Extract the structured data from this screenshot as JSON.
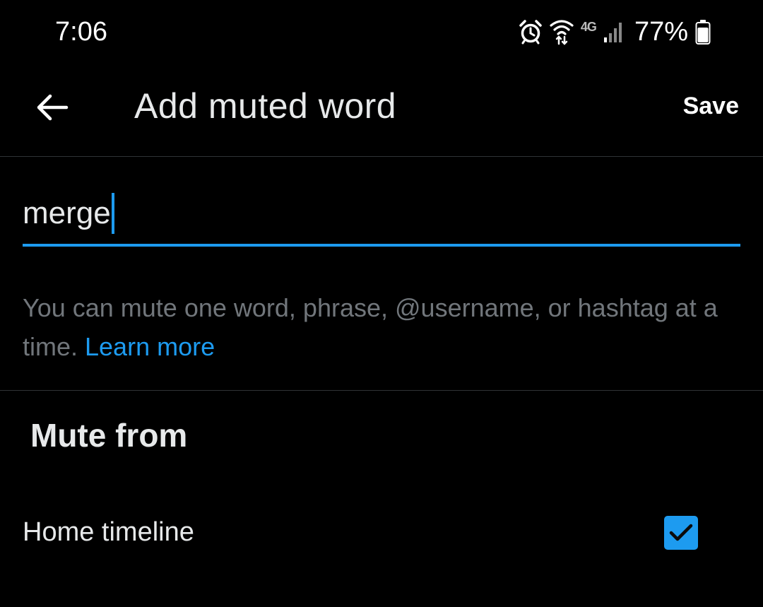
{
  "status_bar": {
    "time": "7:06",
    "network": "4G",
    "battery": "77%",
    "icons": [
      "alarm-icon",
      "wifi-icon",
      "signal-icon",
      "battery-icon"
    ]
  },
  "header": {
    "title": "Add muted word",
    "save_label": "Save",
    "back_icon": "arrow-left-icon"
  },
  "word_input": {
    "value": "merge"
  },
  "helper": {
    "text": "You can mute one word, phrase, @username, or hashtag at a time. ",
    "link_text": "Learn more"
  },
  "mute_from": {
    "title": "Mute from",
    "options": [
      {
        "label": "Home timeline",
        "checked": true
      }
    ]
  },
  "colors": {
    "background": "#000000",
    "accent": "#1d9bf0",
    "text_primary": "#e7e9ea",
    "text_secondary": "#71767b",
    "divider": "#2f3336"
  }
}
